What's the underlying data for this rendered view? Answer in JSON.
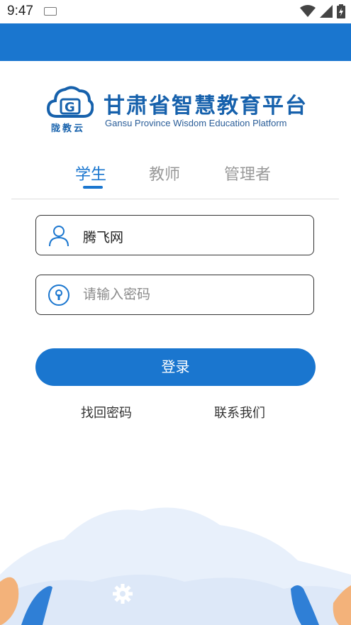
{
  "status": {
    "time": "9:47"
  },
  "logo": {
    "title": "甘肃省智慧教育平台",
    "subtitle": "Gansu Province Wisdom Education Platform",
    "brand": "陇教云",
    "icon_letter": "G"
  },
  "tabs": [
    {
      "label": "学生",
      "active": true
    },
    {
      "label": "教师",
      "active": false
    },
    {
      "label": "管理者",
      "active": false
    }
  ],
  "form": {
    "username": "腾飞网",
    "password_placeholder": "请输入密码"
  },
  "login_label": "登录",
  "links": {
    "forgot": "找回密码",
    "contact": "联系我们"
  },
  "colors": {
    "accent": "#1a76cf",
    "logo": "#1661ac"
  },
  "icons": [
    "keyboard-icon",
    "wifi-icon",
    "signal-icon",
    "battery-icon",
    "user-icon",
    "lock-icon",
    "gear-icon"
  ]
}
